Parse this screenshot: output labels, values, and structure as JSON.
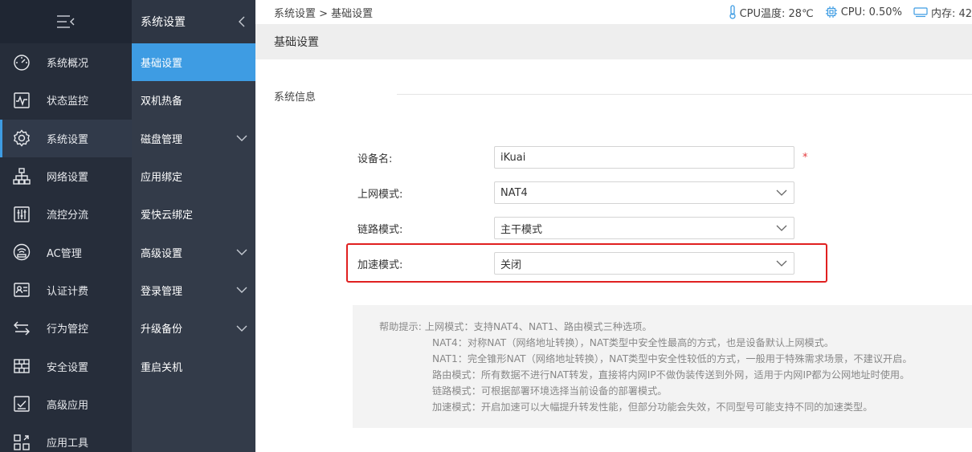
{
  "nav": {
    "items": [
      {
        "label": "系统概况",
        "icon": "dashboard-icon"
      },
      {
        "label": "状态监控",
        "icon": "pulse-monitor-icon"
      },
      {
        "label": "系统设置",
        "icon": "gear-icon",
        "active": true
      },
      {
        "label": "网络设置",
        "icon": "network-icon"
      },
      {
        "label": "流控分流",
        "icon": "sliders-icon"
      },
      {
        "label": "AC管理",
        "icon": "wifi-ap-icon"
      },
      {
        "label": "认证计费",
        "icon": "id-card-icon"
      },
      {
        "label": "行为管控",
        "icon": "swap-arrows-icon"
      },
      {
        "label": "安全设置",
        "icon": "firewall-icon"
      },
      {
        "label": "高级应用",
        "icon": "check-doc-icon"
      },
      {
        "label": "应用工具",
        "icon": "tools-icon"
      }
    ]
  },
  "subnav": {
    "title": "系统设置",
    "items": [
      {
        "label": "基础设置",
        "active": true,
        "has_children": false
      },
      {
        "label": "双机热备",
        "has_children": false
      },
      {
        "label": "磁盘管理",
        "has_children": true
      },
      {
        "label": "应用绑定",
        "has_children": false
      },
      {
        "label": "爱快云绑定",
        "has_children": false
      },
      {
        "label": "高级设置",
        "has_children": true
      },
      {
        "label": "登录管理",
        "has_children": true
      },
      {
        "label": "升级备份",
        "has_children": true
      },
      {
        "label": "重启关机",
        "has_children": false
      }
    ]
  },
  "breadcrumb": "系统设置 > 基础设置",
  "status": {
    "cpu_temp": "CPU温度: 28℃",
    "cpu": "CPU: 0.50%",
    "memory": "内存: 42"
  },
  "page_title": "基础设置",
  "section_title": "系统信息",
  "form": {
    "device_name": {
      "label": "设备名:",
      "value": "iKuai",
      "required_mark": "*"
    },
    "wan_mode": {
      "label": "上网模式:",
      "value": "NAT4"
    },
    "link_mode": {
      "label": "链路模式:",
      "value": "主干模式"
    },
    "accel_mode": {
      "label": "加速模式:",
      "value": "关闭"
    }
  },
  "help": {
    "prefix": "帮助提示:",
    "lines": [
      "上网模式：支持NAT4、NAT1、路由模式三种选项。",
      "NAT4：对称NAT（网络地址转换），NAT类型中安全性最高的方式，也是设备默认上网模式。",
      "NAT1：完全锥形NAT（网络地址转换），NAT类型中安全性较低的方式，一般用于特殊需求场景，不建议开启。",
      "路由模式：所有数据不进行NAT转发，直接将内网IP不做伪装传送到外网，适用于内网IP都为公网地址时使用。",
      "链路模式：可根据部署环境选择当前设备的部署模式。",
      "加速模式：开启加速可以大幅提升转发性能，但部分功能会失效，不同型号可能支持不同的加速类型。"
    ]
  },
  "colors": {
    "sidebar_bg": "#262d3a",
    "subnav_bg": "#333b49",
    "accent": "#3e9ce3",
    "highlight": "#e02020"
  }
}
